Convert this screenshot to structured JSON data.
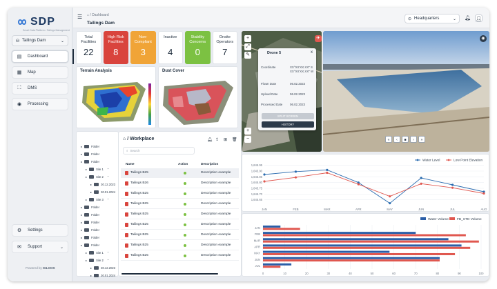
{
  "brand": {
    "name": "SDP",
    "tagline": "Smart Data Platform • Tailings Management",
    "powered_prefix": "Powered by",
    "powered_name": "IGLOOS"
  },
  "site_selector": {
    "value": "Tailings Dam"
  },
  "nav": [
    {
      "label": "Dashboard",
      "icon": "dashboard-icon",
      "active": true
    },
    {
      "label": "Map",
      "icon": "map-icon"
    },
    {
      "label": "DMS",
      "icon": "dms-icon"
    },
    {
      "label": "Processing",
      "icon": "processing-icon"
    }
  ],
  "bottom_nav": {
    "settings": "Settings",
    "support": "Support"
  },
  "header": {
    "breadcrumb": "/ Dashboard",
    "title": "Tailings Dam",
    "location": "Headquarters"
  },
  "stats": [
    {
      "label": "Total Facilities",
      "value": "22",
      "color": "#ffffff"
    },
    {
      "label": "High Risk Facilities",
      "value": "8",
      "color": "#d9443d"
    },
    {
      "label": "Non-Compliant",
      "value": "3",
      "color": "#f0a437"
    },
    {
      "label": "Inactive",
      "value": "4",
      "color": "#ffffff"
    },
    {
      "label": "Stability Concerns",
      "value": "0",
      "color": "#7cc142"
    },
    {
      "label": "Onsite Operators",
      "value": "7",
      "color": "#ffffff"
    }
  ],
  "terrain": {
    "title": "Terrain Analysis"
  },
  "dust": {
    "title": "Dust Cover"
  },
  "tree": [
    {
      "label": "Folder",
      "level": 0
    },
    {
      "label": "Folder",
      "level": 0
    },
    {
      "label": "Folder",
      "level": 0
    },
    {
      "label": "Site 1",
      "level": 1
    },
    {
      "label": "Site 2",
      "level": 1
    },
    {
      "label": "30.12.2023",
      "level": 2
    },
    {
      "label": "30.01.2024",
      "level": 2
    },
    {
      "label": "Site 3",
      "level": 1
    },
    {
      "label": "Folder",
      "level": 0
    },
    {
      "label": "Folder",
      "level": 0
    },
    {
      "label": "Folder",
      "level": 0
    },
    {
      "label": "Folder",
      "level": 0
    },
    {
      "label": "Folder",
      "level": 0
    },
    {
      "label": "Folder",
      "level": 0
    },
    {
      "label": "Site 1",
      "level": 1
    },
    {
      "label": "Site 2",
      "level": 1
    },
    {
      "label": "30.12.2023",
      "level": 2
    },
    {
      "label": "30.01.2024",
      "level": 2
    }
  ],
  "workplace": {
    "title": "/ Workplace",
    "search_placeholder": "Search",
    "columns": {
      "name": "Name",
      "action": "Action",
      "description": "Description"
    },
    "rows": [
      {
        "name": "Tailings B25",
        "description": "Description example"
      },
      {
        "name": "Tailings B26",
        "description": "Description example"
      },
      {
        "name": "Tailings B25",
        "description": "Description example"
      },
      {
        "name": "Tailings B25",
        "description": "Description example"
      },
      {
        "name": "Tailings B25",
        "description": "Description example"
      },
      {
        "name": "Tailings B25",
        "description": "Description example"
      },
      {
        "name": "Tailings B25",
        "description": "Description example"
      },
      {
        "name": "Tailings B25",
        "description": "Description example"
      },
      {
        "name": "Tailings B25",
        "description": "Description example"
      }
    ]
  },
  "drone_popup": {
    "title": "Drone 5",
    "close": "x",
    "coordinate_label": "Coordinate",
    "coordinate_value": "XX°XX'XX.XX\" S XX°XX'XX.XX\" W",
    "flown_label": "Flown Date",
    "flown_value": "06.02.2023",
    "upload_label": "Upload Date",
    "upload_value": "06.02.2023",
    "processed_label": "Processed Date",
    "processed_value": "06.02.2023",
    "split_button": "SPLIT SCREEN",
    "history_button": "HISTORY"
  },
  "chart_data": [
    {
      "type": "line",
      "x": [
        "JAN",
        "FEB",
        "MAR",
        "APR",
        "MAY",
        "JUN",
        "JUL",
        "AUG"
      ],
      "ylim": [
        1645.6,
        1645.96
      ],
      "yticks": [
        "1,645.95",
        "1,645.90",
        "1,645.85",
        "1,645.80",
        "1,645.75",
        "1,645.70",
        "1,645.65"
      ],
      "series": [
        {
          "name": "Water Level",
          "color": "#2b6cb0",
          "values": [
            1645.87,
            1645.895,
            1645.91,
            1645.8,
            1645.62,
            1645.84,
            1645.78,
            1645.72
          ]
        },
        {
          "name": "Low Point Elevation",
          "color": "#e0574f",
          "values": [
            1645.81,
            1645.845,
            1645.885,
            1645.785,
            1645.68,
            1645.79,
            1645.755,
            1645.705
          ]
        }
      ]
    },
    {
      "type": "bar",
      "orientation": "horizontal",
      "categories": [
        "JAN",
        "FEB",
        "MAR",
        "APR",
        "MAY",
        "JUN",
        "JUL"
      ],
      "xlim": [
        0,
        100
      ],
      "xticks": [
        "0",
        "10",
        "20",
        "30",
        "40",
        "50",
        "60",
        "70",
        "80",
        "90",
        "100"
      ],
      "series": [
        {
          "name": "Water Volume",
          "color": "#2b5ea7",
          "values": [
            8,
            70,
            85,
            91,
            58,
            81,
            13
          ]
        },
        {
          "name": "FB_STD Volume",
          "color": "#e0574f",
          "values": [
            17,
            93,
            99,
            95,
            88,
            81,
            8
          ]
        }
      ]
    }
  ]
}
